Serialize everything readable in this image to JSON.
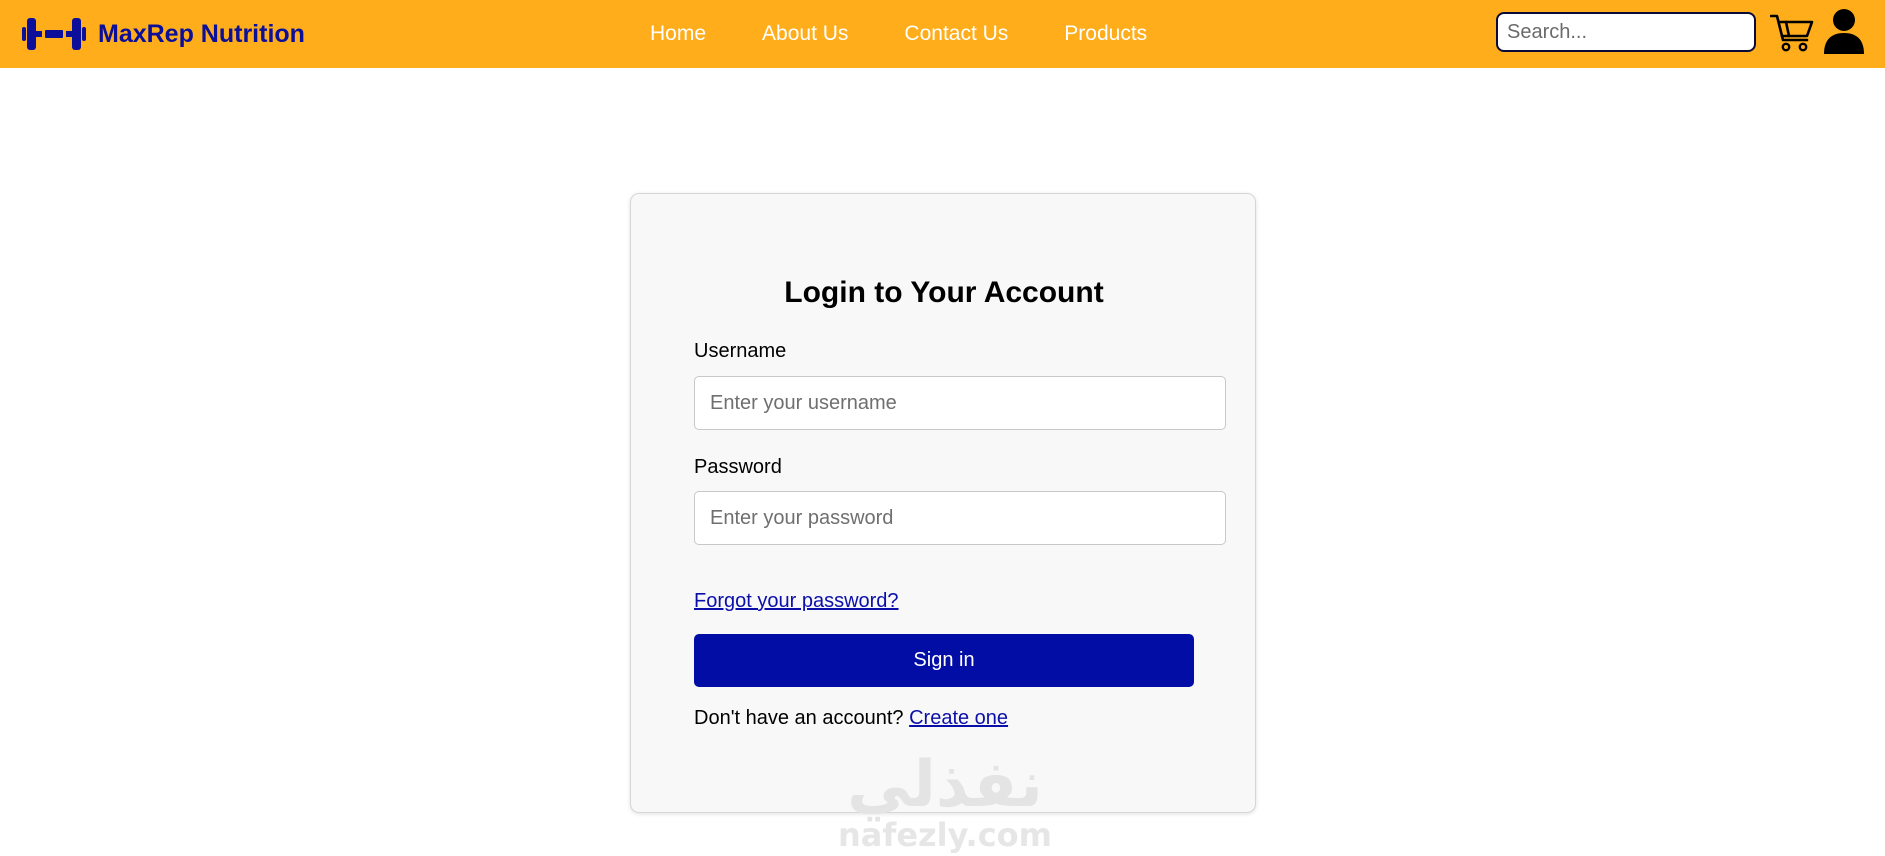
{
  "brand": {
    "name": "MaxRep Nutrition",
    "logo_icon": "dumbbell-icon",
    "color": "#0b0f99"
  },
  "nav": {
    "background": "#ffad1a",
    "links": [
      {
        "label": "Home"
      },
      {
        "label": "About Us"
      },
      {
        "label": "Contact Us"
      },
      {
        "label": "Products"
      }
    ]
  },
  "search": {
    "placeholder": "Search...",
    "value": ""
  },
  "header_icons": [
    "cart-icon",
    "user-icon"
  ],
  "login": {
    "title": "Login to Your Account",
    "username_label": "Username",
    "username_placeholder": "Enter your username",
    "password_label": "Password",
    "password_placeholder": "Enter your password",
    "forgot_link": "Forgot your password?",
    "signin_button": "Sign in",
    "signup_prompt": "Don't have an account?",
    "signup_link": "Create one",
    "button_color": "#020da6"
  },
  "watermark": {
    "arabic": "نفذلي",
    "latin": "nafezly.com"
  }
}
